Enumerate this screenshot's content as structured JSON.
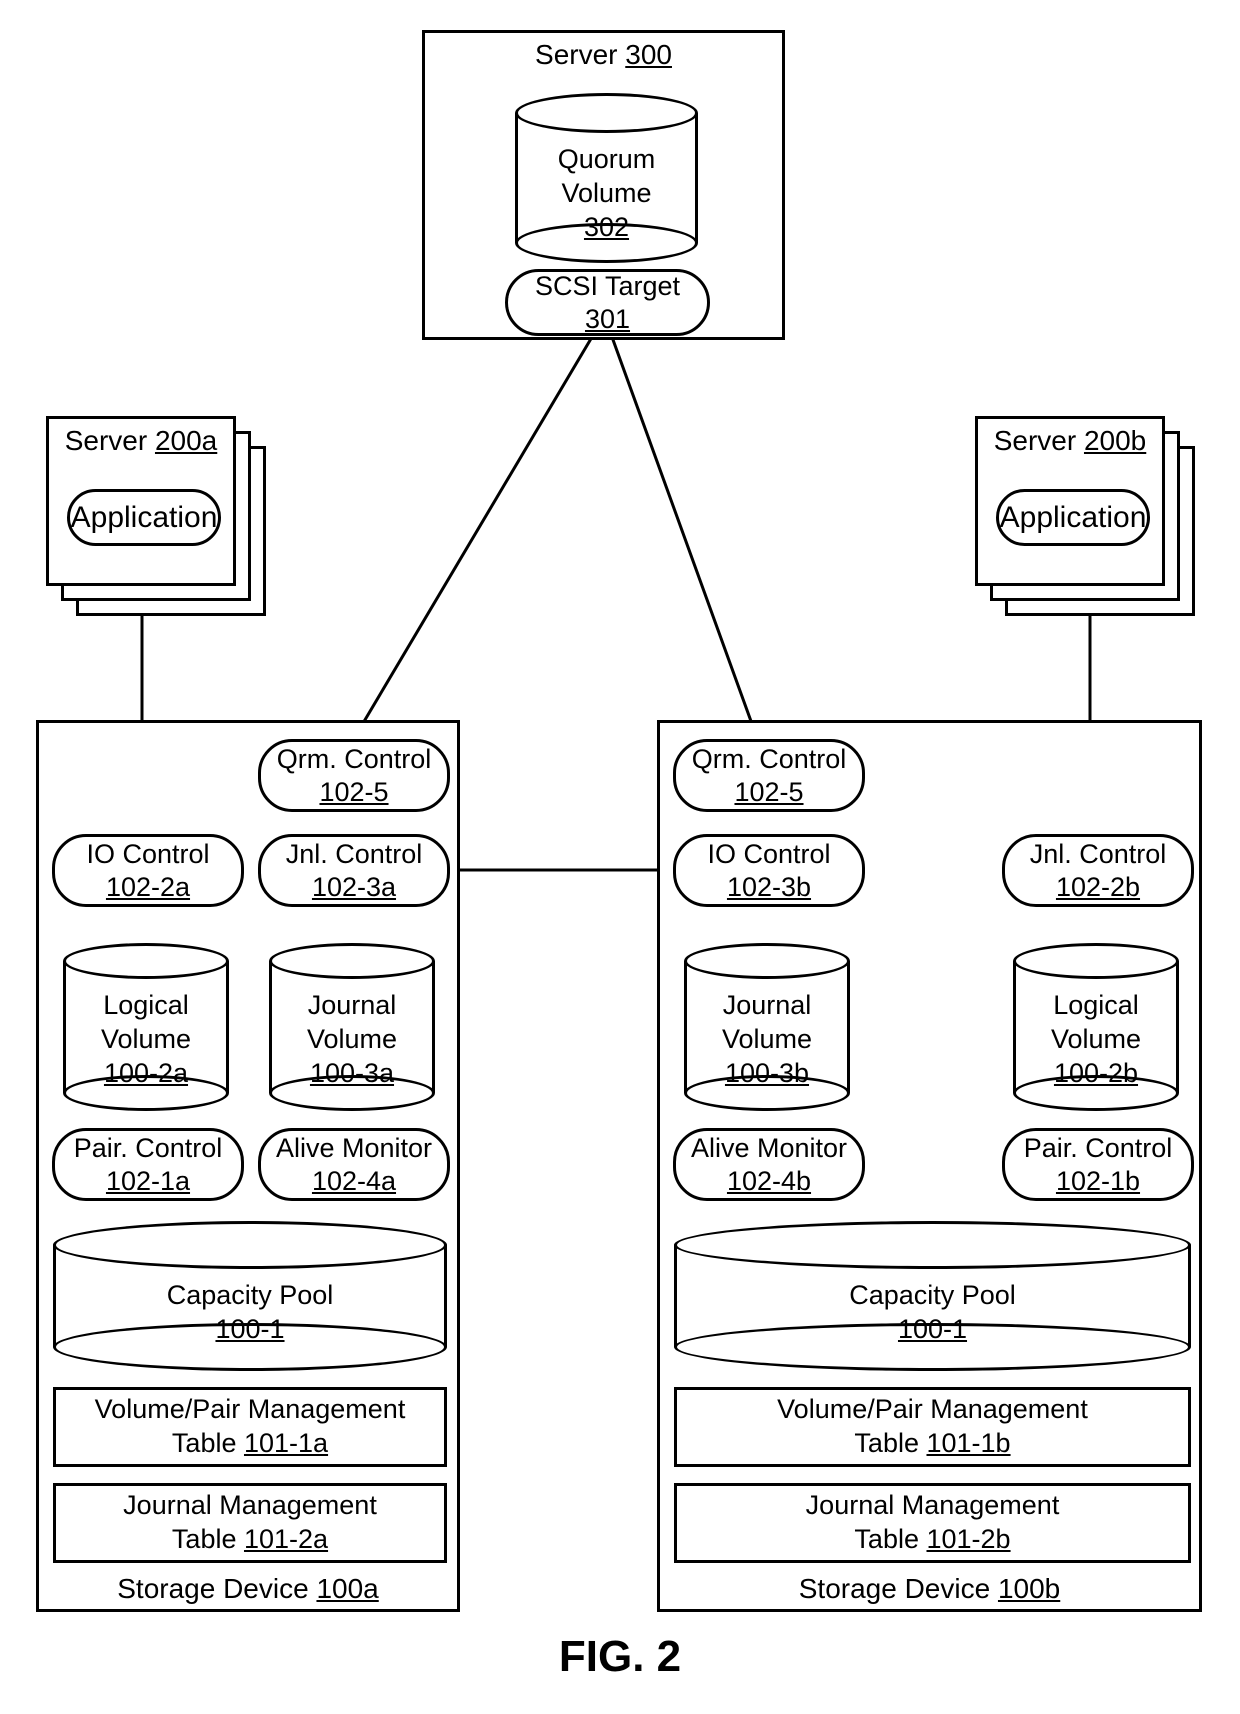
{
  "figure_caption": "FIG. 2",
  "server300": {
    "title_prefix": "Server",
    "ref": "300",
    "quorum_volume": {
      "line1": "Quorum",
      "line2": "Volume",
      "ref": "302"
    },
    "scsi_target": {
      "label": "SCSI Target",
      "ref": "301"
    }
  },
  "server200a": {
    "title_prefix": "Server",
    "ref": "200a",
    "application_label": "Application"
  },
  "server200b": {
    "title_prefix": "Server",
    "ref": "200b",
    "application_label": "Application"
  },
  "storage_a": {
    "footer_prefix": "Storage Device",
    "ref": "100a",
    "qrm_control": {
      "label": "Qrm. Control",
      "ref": "102-5"
    },
    "io_control": {
      "label": "IO Control",
      "ref": "102-2a"
    },
    "jnl_control": {
      "label": "Jnl. Control",
      "ref": "102-3a"
    },
    "logical_vol": {
      "line1": "Logical",
      "line2": "Volume",
      "ref": "100-2a"
    },
    "journal_vol": {
      "line1": "Journal",
      "line2": "Volume",
      "ref": "100-3a"
    },
    "pair_control": {
      "label": "Pair. Control",
      "ref": "102-1a"
    },
    "alive_monitor": {
      "label": "Alive Monitor",
      "ref": "102-4a"
    },
    "capacity_pool": {
      "label": "Capacity Pool",
      "ref": "100-1"
    },
    "table_vpm": {
      "line1": "Volume/Pair Management",
      "line2_prefix": "Table",
      "ref": "101-1a"
    },
    "table_jm": {
      "line1": "Journal Management",
      "line2_prefix": "Table",
      "ref": "101-2a"
    }
  },
  "storage_b": {
    "footer_prefix": "Storage Device",
    "ref": "100b",
    "qrm_control": {
      "label": "Qrm. Control",
      "ref": "102-5"
    },
    "io_control": {
      "label": "IO Control",
      "ref": "102-3b"
    },
    "jnl_control": {
      "label": "Jnl. Control",
      "ref": "102-2b"
    },
    "journal_vol": {
      "line1": "Journal",
      "line2": "Volume",
      "ref": "100-3b"
    },
    "logical_vol": {
      "line1": "Logical",
      "line2": "Volume",
      "ref": "100-2b"
    },
    "alive_monitor": {
      "label": "Alive Monitor",
      "ref": "102-4b"
    },
    "pair_control": {
      "label": "Pair. Control",
      "ref": "102-1b"
    },
    "capacity_pool": {
      "label": "Capacity Pool",
      "ref": "100-1"
    },
    "table_vpm": {
      "line1": "Volume/Pair Management",
      "line2_prefix": "Table",
      "ref": "101-1b"
    },
    "table_jm": {
      "line1": "Journal Management",
      "line2_prefix": "Table",
      "ref": "101-2b"
    }
  }
}
